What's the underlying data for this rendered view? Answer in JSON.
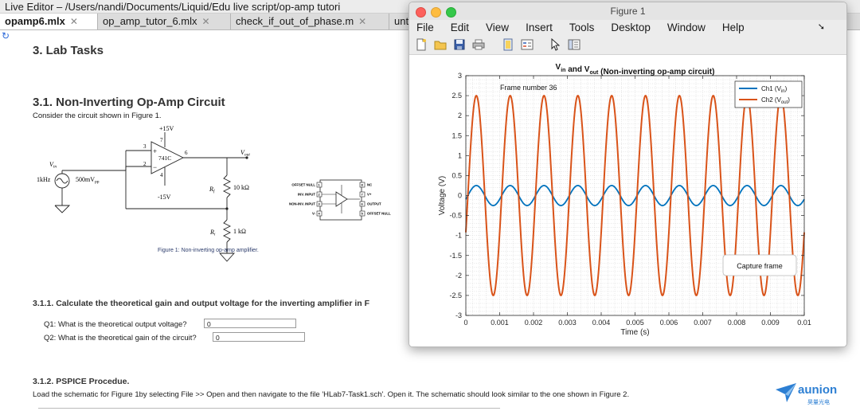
{
  "editor": {
    "title": "Live Editor – /Users/nandi/Documents/Liquid/Edu live script/op-amp tutori",
    "tabs": [
      {
        "label": "opamp6.mlx",
        "close": "✕"
      },
      {
        "label": "op_amp_tutor_6.mlx",
        "close": "✕"
      },
      {
        "label": "check_if_out_of_phase.m",
        "close": "✕"
      },
      {
        "label": "unt",
        "close": ""
      }
    ]
  },
  "doc": {
    "h_lab": "3. Lab Tasks",
    "h_circuit": "3.1. Non-Inverting Op-Amp Circuit",
    "intro": "Consider the circuit shown in Figure 1.",
    "schematic": {
      "vplus": "+15V",
      "vminus": "-15V",
      "vin": "V",
      "vin_sub": "in",
      "freq": "1kHz",
      "amp": "500mV",
      "amp_sub": "pp",
      "chip": "741C",
      "pin3": "3",
      "pin2": "2",
      "pin7": "7",
      "pin4": "4",
      "pin6": "6",
      "vout": "V",
      "vout_sub": "out",
      "rf": "R",
      "rf_sub": "f",
      "rf_val": "10 kΩ",
      "ri": "R",
      "ri_sub": "i",
      "ri_val": "1 kΩ",
      "plus": "+",
      "minus": "−"
    },
    "pinout": {
      "left": [
        "OFFSET NULL",
        "INV. INPUT",
        "NON-INV. INPUT",
        "V-"
      ],
      "left_nums": [
        "1",
        "2",
        "3",
        "4"
      ],
      "right": [
        "NC",
        "V+",
        "OUTPUT",
        "OFFSET NULL"
      ],
      "right_nums": [
        "8",
        "7",
        "6",
        "5"
      ]
    },
    "caption": "Figure 1: Non-inverting op-amp amplifier.",
    "h_calc": "3.1.1. Calculate the theoretical gain and output voltage for the inverting amplifier in F",
    "q1_label": "Q1: What is the theoretical output voltage?",
    "q1_value": "0",
    "q2_label": "Q2: What is the theoretical gain of the circuit?",
    "q2_value": "0",
    "h_pspice": "3.1.2. PSPICE Procedue.",
    "pspice_text": "Load the schematic for Figure 1by selecting File >> Open and then navigate to the file 'HLab7-Task1.sch'. Open it. The schematic should look similar to the one shown in Figure 2."
  },
  "figure": {
    "window_title": "Figure 1",
    "menu": [
      "File",
      "Edit",
      "View",
      "Insert",
      "Tools",
      "Desktop",
      "Window",
      "Help"
    ],
    "dock_glyph": "➘",
    "toolbar": [
      "new-file-icon",
      "open-folder-icon",
      "save-icon",
      "print-icon",
      "link-plot-icon",
      "insert-legend-icon",
      "pointer-icon",
      "property-inspector-icon"
    ],
    "frame_label": "Frame number 36",
    "capture_label": "Capture frame"
  },
  "chart_data": {
    "type": "line",
    "title_parts": [
      {
        "text": "V",
        "sub": "in"
      },
      {
        "text": " and V",
        "sub": "out"
      },
      {
        "text": " (Non-inverting op-amp circuit)",
        "sub": ""
      }
    ],
    "xlabel": "Time (s)",
    "ylabel": "Voltage (V)",
    "xlim": [
      0,
      0.01
    ],
    "ylim": [
      -3,
      3
    ],
    "xticks": [
      "0",
      "0.001",
      "0.002",
      "0.003",
      "0.004",
      "0.005",
      "0.006",
      "0.007",
      "0.008",
      "0.009",
      "0.01"
    ],
    "yticks": [
      "3",
      "2.5",
      "2",
      "1.5",
      "1",
      "0.5",
      "0",
      "-0.5",
      "-1",
      "-1.5",
      "-2",
      "-2.5",
      "-3"
    ],
    "grid": "minor-dotted",
    "legend_position": "top-right",
    "series": [
      {
        "name": "Ch1 (V",
        "name_sub": "in",
        "color": "#0072bd",
        "frequency_hz": 1000,
        "amplitude_v": 0.25,
        "phase_cycles": 0.94
      },
      {
        "name": "Ch2 (V",
        "name_sub": "out",
        "color": "#d95319",
        "frequency_hz": 1000,
        "amplitude_v": 2.5,
        "phase_cycles": 0.94
      }
    ]
  }
}
